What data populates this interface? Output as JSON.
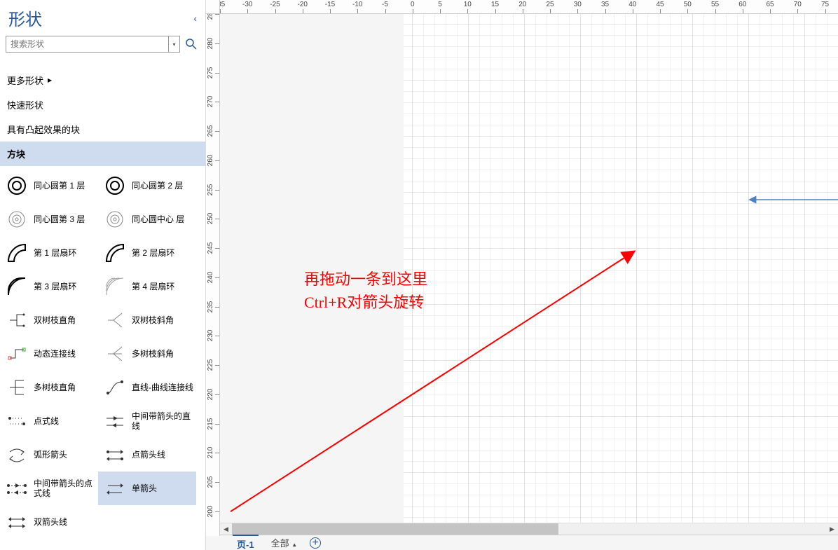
{
  "sidebar": {
    "title": "形状",
    "search_placeholder": "搜索形状",
    "categories": {
      "more": "更多形状",
      "quick": "快速形状",
      "blocks_raised": "具有凸起效果的块",
      "blocks": "方块"
    },
    "shapes": [
      {
        "label": "同心圆第 1 层",
        "icon": "concentric"
      },
      {
        "label": "同心圆第 2 层",
        "icon": "concentric"
      },
      {
        "label": "同心圆第 3 层",
        "icon": "concentric-thin"
      },
      {
        "label": "同心圆中心 层",
        "icon": "concentric-thin"
      },
      {
        "label": "第 1 层扇环",
        "icon": "fan1"
      },
      {
        "label": "第 2 层扇环",
        "icon": "fan2"
      },
      {
        "label": "第 3 层扇环",
        "icon": "fan3"
      },
      {
        "label": "第 4 层扇环",
        "icon": "fan4"
      },
      {
        "label": "双树枝直角",
        "icon": "branch-right"
      },
      {
        "label": "双树枝斜角",
        "icon": "branch-angle"
      },
      {
        "label": "动态连接线",
        "icon": "dynamic-conn"
      },
      {
        "label": "多树枝斜角",
        "icon": "multi-branch"
      },
      {
        "label": "多树枝直角",
        "icon": "multi-branch-right"
      },
      {
        "label": "直线-曲线连接线",
        "icon": "line-curve"
      },
      {
        "label": "点式线",
        "icon": "dotted"
      },
      {
        "label": "中间带箭头的直线",
        "icon": "mid-arrow"
      },
      {
        "label": "弧形箭头",
        "icon": "arc-arrow"
      },
      {
        "label": "点箭头线",
        "icon": "dot-arrow"
      },
      {
        "label": "中间带箭头的点式线",
        "icon": "mid-arrow-dot"
      },
      {
        "label": "单箭头",
        "icon": "single-arrow"
      },
      {
        "label": "双箭头线",
        "icon": "double-arrow"
      }
    ],
    "selected_shape_index": 19
  },
  "ruler": {
    "h_start": -35,
    "h_end": 80,
    "h_step": 5,
    "v_start": 285,
    "v_end": 200,
    "v_step": 5
  },
  "canvas": {
    "annotation_line1": "再拖动一条到这里",
    "annotation_line2": "Ctrl+R对箭头旋转",
    "annotation_color": "#ff0000",
    "arrow_cross": {
      "stroke": "#4f81bd",
      "top": {
        "type": "arrow-out"
      },
      "bottom": {
        "type": "arrow-out"
      },
      "left": {
        "type": "arrow-out"
      },
      "right": {
        "type": "arrow-out"
      }
    },
    "annotation_arrow": {
      "stroke": "#ff0000"
    }
  },
  "footer": {
    "page_name": "页-1",
    "all_label": "全部"
  }
}
